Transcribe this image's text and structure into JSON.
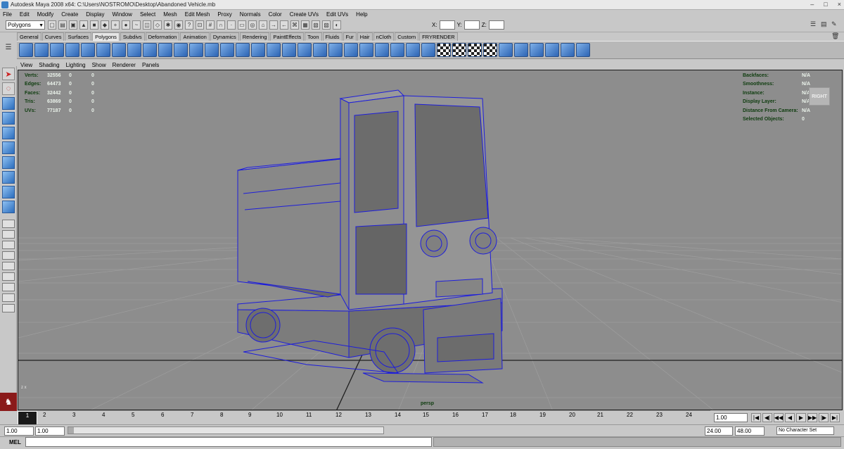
{
  "window": {
    "title": "Autodesk Maya 2008 x64: C:\\Users\\NOSTROMO\\Desktop\\Abandoned Vehicle.mb",
    "controls": [
      "–",
      "□",
      "×"
    ]
  },
  "menubar": [
    "File",
    "Edit",
    "Modify",
    "Create",
    "Display",
    "Window",
    "Select",
    "Mesh",
    "Edit Mesh",
    "Proxy",
    "Normals",
    "Color",
    "Create UVs",
    "Edit UVs",
    "Help"
  ],
  "statusline": {
    "menu_set": "Polygons",
    "x_label": "X:",
    "y_label": "Y:",
    "z_label": "Z:"
  },
  "shelf_tabs": [
    "General",
    "Curves",
    "Surfaces",
    "Polygons",
    "Subdivs",
    "Deformation",
    "Animation",
    "Dynamics",
    "Rendering",
    "PaintEffects",
    "Toon",
    "Fluids",
    "Fur",
    "Hair",
    "nCloth",
    "Custom",
    "FRYRENDER"
  ],
  "active_shelf": "Polygons",
  "panel_menu": [
    "View",
    "Shading",
    "Lighting",
    "Show",
    "Renderer",
    "Panels"
  ],
  "hud_left": [
    {
      "label": "Verts:",
      "v1": "32556",
      "v2": "0",
      "v3": "0"
    },
    {
      "label": "Edges:",
      "v1": "64473",
      "v2": "0",
      "v3": "0"
    },
    {
      "label": "Faces:",
      "v1": "32442",
      "v2": "0",
      "v3": "0"
    },
    {
      "label": "Tris:",
      "v1": "63869",
      "v2": "0",
      "v3": "0"
    },
    {
      "label": "UVs:",
      "v1": "77187",
      "v2": "0",
      "v3": "0"
    }
  ],
  "hud_right": [
    {
      "label": "Backfaces:",
      "value": "N/A"
    },
    {
      "label": "Smoothness:",
      "value": "N/A"
    },
    {
      "label": "Instance:",
      "value": "N/A"
    },
    {
      "label": "Display Layer:",
      "value": "N/A"
    },
    {
      "label": "Distance From Camera:",
      "value": "N/A"
    },
    {
      "label": "Selected Objects:",
      "value": "0"
    }
  ],
  "viewcube_label": "RIGHT",
  "camera_label": "persp",
  "axis_label": "z x",
  "timeline": {
    "current_frame": "1",
    "ticks": [
      "2",
      "3",
      "4",
      "5",
      "6",
      "7",
      "8",
      "9",
      "10",
      "11",
      "12",
      "13",
      "14",
      "15",
      "16",
      "17",
      "18",
      "19",
      "20",
      "21",
      "22",
      "23",
      "24"
    ],
    "current_time_field": "1.00"
  },
  "range": {
    "start": "1.00",
    "anim_start": "1.00",
    "end": "24.00",
    "anim_end": "48.00",
    "character_set": "No Character Set"
  },
  "cmdline": {
    "label": "MEL"
  },
  "colors": {
    "viewport_bg": "#8d8d8d",
    "wire": "#1d1ddb",
    "hud_label": "#0e3c0e"
  }
}
